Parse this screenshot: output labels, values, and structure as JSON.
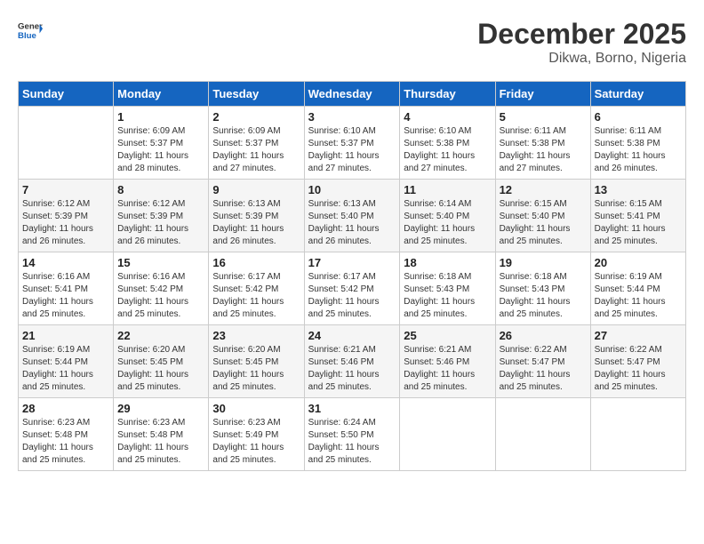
{
  "logo": {
    "general": "General",
    "blue": "Blue"
  },
  "title": "December 2025",
  "subtitle": "Dikwa, Borno, Nigeria",
  "days_of_week": [
    "Sunday",
    "Monday",
    "Tuesday",
    "Wednesday",
    "Thursday",
    "Friday",
    "Saturday"
  ],
  "weeks": [
    [
      {
        "day": "",
        "sunrise": "",
        "sunset": "",
        "daylight": ""
      },
      {
        "day": "1",
        "sunrise": "Sunrise: 6:09 AM",
        "sunset": "Sunset: 5:37 PM",
        "daylight": "Daylight: 11 hours and 28 minutes."
      },
      {
        "day": "2",
        "sunrise": "Sunrise: 6:09 AM",
        "sunset": "Sunset: 5:37 PM",
        "daylight": "Daylight: 11 hours and 27 minutes."
      },
      {
        "day": "3",
        "sunrise": "Sunrise: 6:10 AM",
        "sunset": "Sunset: 5:37 PM",
        "daylight": "Daylight: 11 hours and 27 minutes."
      },
      {
        "day": "4",
        "sunrise": "Sunrise: 6:10 AM",
        "sunset": "Sunset: 5:38 PM",
        "daylight": "Daylight: 11 hours and 27 minutes."
      },
      {
        "day": "5",
        "sunrise": "Sunrise: 6:11 AM",
        "sunset": "Sunset: 5:38 PM",
        "daylight": "Daylight: 11 hours and 27 minutes."
      },
      {
        "day": "6",
        "sunrise": "Sunrise: 6:11 AM",
        "sunset": "Sunset: 5:38 PM",
        "daylight": "Daylight: 11 hours and 26 minutes."
      }
    ],
    [
      {
        "day": "7",
        "sunrise": "Sunrise: 6:12 AM",
        "sunset": "Sunset: 5:39 PM",
        "daylight": "Daylight: 11 hours and 26 minutes."
      },
      {
        "day": "8",
        "sunrise": "Sunrise: 6:12 AM",
        "sunset": "Sunset: 5:39 PM",
        "daylight": "Daylight: 11 hours and 26 minutes."
      },
      {
        "day": "9",
        "sunrise": "Sunrise: 6:13 AM",
        "sunset": "Sunset: 5:39 PM",
        "daylight": "Daylight: 11 hours and 26 minutes."
      },
      {
        "day": "10",
        "sunrise": "Sunrise: 6:13 AM",
        "sunset": "Sunset: 5:40 PM",
        "daylight": "Daylight: 11 hours and 26 minutes."
      },
      {
        "day": "11",
        "sunrise": "Sunrise: 6:14 AM",
        "sunset": "Sunset: 5:40 PM",
        "daylight": "Daylight: 11 hours and 25 minutes."
      },
      {
        "day": "12",
        "sunrise": "Sunrise: 6:15 AM",
        "sunset": "Sunset: 5:40 PM",
        "daylight": "Daylight: 11 hours and 25 minutes."
      },
      {
        "day": "13",
        "sunrise": "Sunrise: 6:15 AM",
        "sunset": "Sunset: 5:41 PM",
        "daylight": "Daylight: 11 hours and 25 minutes."
      }
    ],
    [
      {
        "day": "14",
        "sunrise": "Sunrise: 6:16 AM",
        "sunset": "Sunset: 5:41 PM",
        "daylight": "Daylight: 11 hours and 25 minutes."
      },
      {
        "day": "15",
        "sunrise": "Sunrise: 6:16 AM",
        "sunset": "Sunset: 5:42 PM",
        "daylight": "Daylight: 11 hours and 25 minutes."
      },
      {
        "day": "16",
        "sunrise": "Sunrise: 6:17 AM",
        "sunset": "Sunset: 5:42 PM",
        "daylight": "Daylight: 11 hours and 25 minutes."
      },
      {
        "day": "17",
        "sunrise": "Sunrise: 6:17 AM",
        "sunset": "Sunset: 5:42 PM",
        "daylight": "Daylight: 11 hours and 25 minutes."
      },
      {
        "day": "18",
        "sunrise": "Sunrise: 6:18 AM",
        "sunset": "Sunset: 5:43 PM",
        "daylight": "Daylight: 11 hours and 25 minutes."
      },
      {
        "day": "19",
        "sunrise": "Sunrise: 6:18 AM",
        "sunset": "Sunset: 5:43 PM",
        "daylight": "Daylight: 11 hours and 25 minutes."
      },
      {
        "day": "20",
        "sunrise": "Sunrise: 6:19 AM",
        "sunset": "Sunset: 5:44 PM",
        "daylight": "Daylight: 11 hours and 25 minutes."
      }
    ],
    [
      {
        "day": "21",
        "sunrise": "Sunrise: 6:19 AM",
        "sunset": "Sunset: 5:44 PM",
        "daylight": "Daylight: 11 hours and 25 minutes."
      },
      {
        "day": "22",
        "sunrise": "Sunrise: 6:20 AM",
        "sunset": "Sunset: 5:45 PM",
        "daylight": "Daylight: 11 hours and 25 minutes."
      },
      {
        "day": "23",
        "sunrise": "Sunrise: 6:20 AM",
        "sunset": "Sunset: 5:45 PM",
        "daylight": "Daylight: 11 hours and 25 minutes."
      },
      {
        "day": "24",
        "sunrise": "Sunrise: 6:21 AM",
        "sunset": "Sunset: 5:46 PM",
        "daylight": "Daylight: 11 hours and 25 minutes."
      },
      {
        "day": "25",
        "sunrise": "Sunrise: 6:21 AM",
        "sunset": "Sunset: 5:46 PM",
        "daylight": "Daylight: 11 hours and 25 minutes."
      },
      {
        "day": "26",
        "sunrise": "Sunrise: 6:22 AM",
        "sunset": "Sunset: 5:47 PM",
        "daylight": "Daylight: 11 hours and 25 minutes."
      },
      {
        "day": "27",
        "sunrise": "Sunrise: 6:22 AM",
        "sunset": "Sunset: 5:47 PM",
        "daylight": "Daylight: 11 hours and 25 minutes."
      }
    ],
    [
      {
        "day": "28",
        "sunrise": "Sunrise: 6:23 AM",
        "sunset": "Sunset: 5:48 PM",
        "daylight": "Daylight: 11 hours and 25 minutes."
      },
      {
        "day": "29",
        "sunrise": "Sunrise: 6:23 AM",
        "sunset": "Sunset: 5:48 PM",
        "daylight": "Daylight: 11 hours and 25 minutes."
      },
      {
        "day": "30",
        "sunrise": "Sunrise: 6:23 AM",
        "sunset": "Sunset: 5:49 PM",
        "daylight": "Daylight: 11 hours and 25 minutes."
      },
      {
        "day": "31",
        "sunrise": "Sunrise: 6:24 AM",
        "sunset": "Sunset: 5:50 PM",
        "daylight": "Daylight: 11 hours and 25 minutes."
      },
      {
        "day": "",
        "sunrise": "",
        "sunset": "",
        "daylight": ""
      },
      {
        "day": "",
        "sunrise": "",
        "sunset": "",
        "daylight": ""
      },
      {
        "day": "",
        "sunrise": "",
        "sunset": "",
        "daylight": ""
      }
    ]
  ]
}
